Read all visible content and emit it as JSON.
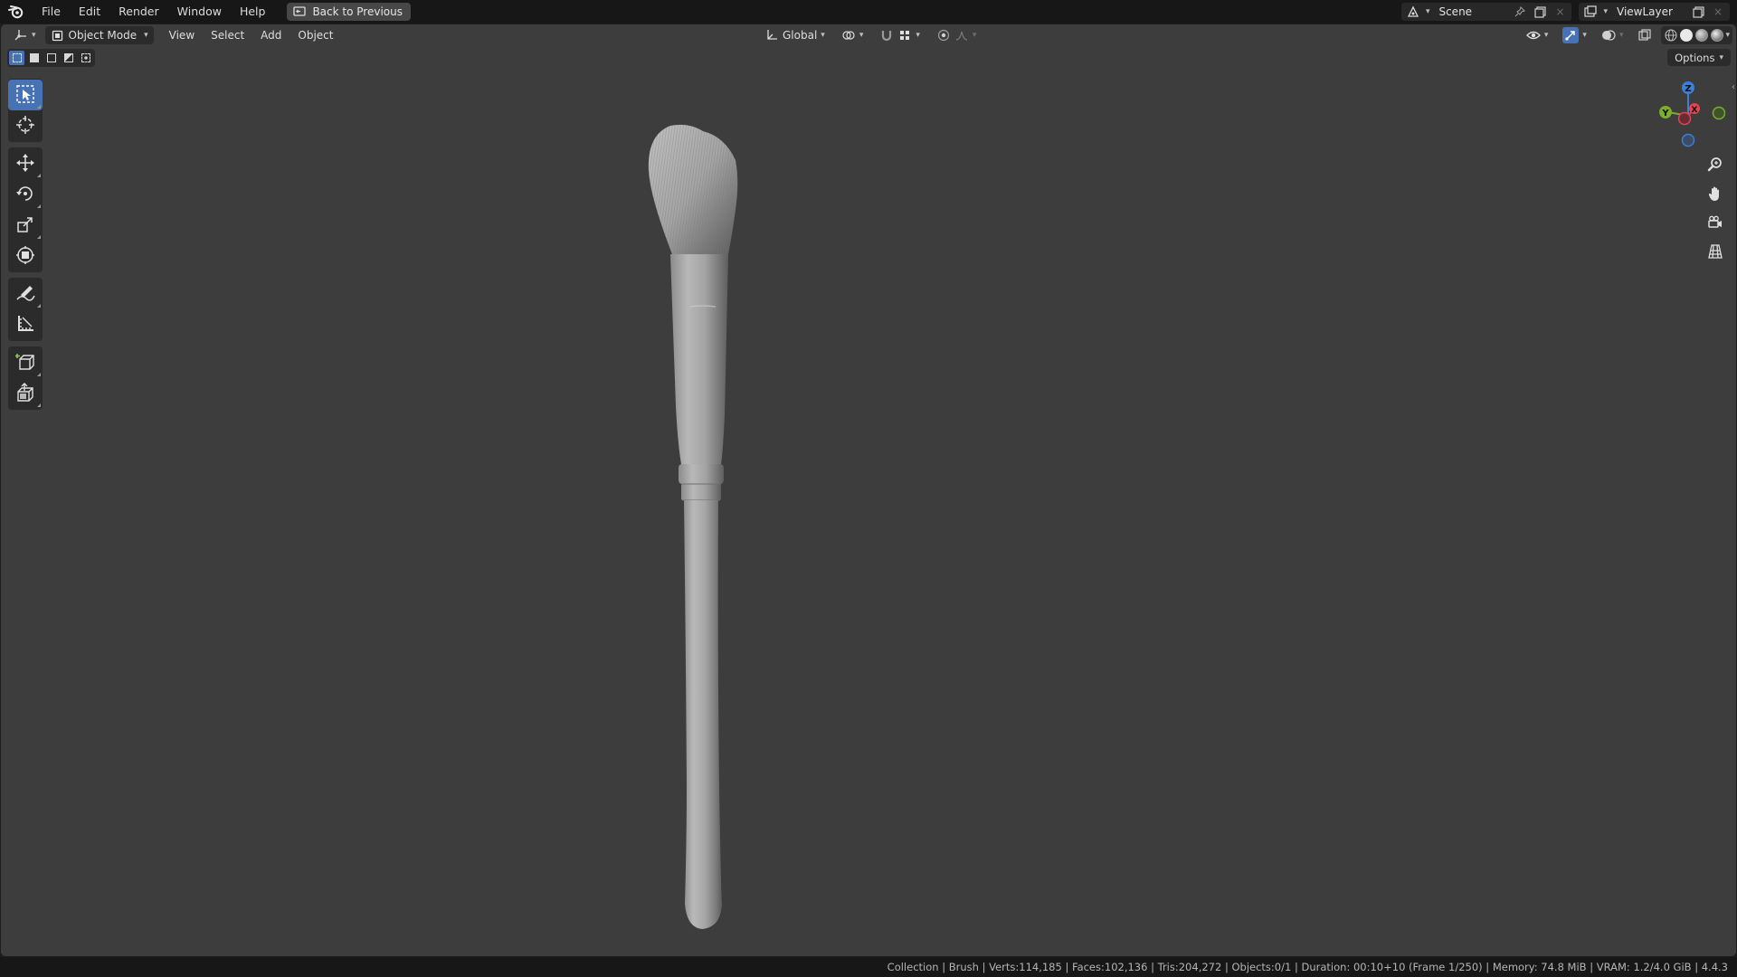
{
  "menu": {
    "file": "File",
    "edit": "Edit",
    "render": "Render",
    "window": "Window",
    "help": "Help",
    "back_to_previous": "Back to Previous"
  },
  "topbar_right": {
    "scene": "Scene",
    "view_layer": "ViewLayer"
  },
  "viewport_header": {
    "mode": "Object Mode",
    "menus": [
      "View",
      "Select",
      "Add",
      "Object"
    ],
    "transform_orientation": "Global",
    "options": "Options"
  },
  "gizmo": {
    "z_label": "Z",
    "y_label": "Y",
    "x_label": "X"
  },
  "toolbar": {
    "tools": [
      "select-box",
      "cursor",
      "move",
      "rotate",
      "scale",
      "transform",
      "annotate",
      "measure",
      "add-cube",
      "extrude"
    ],
    "active_tool": "select-box"
  },
  "colors": {
    "accent": "#4772b3",
    "viewport_bg": "#3d3d3d",
    "axis_x": "#e2454f",
    "axis_y": "#7cad2b",
    "axis_z": "#3d7fd6"
  },
  "statusbar": {
    "text": "Collection | Brush | Verts:114,185 | Faces:102,136 | Tris:204,272 | Objects:0/1 | Duration: 00:10+10 (Frame 1/250) | Memory: 74.8 MiB | VRAM: 1.2/4.0 GiB | 4.4.3"
  }
}
